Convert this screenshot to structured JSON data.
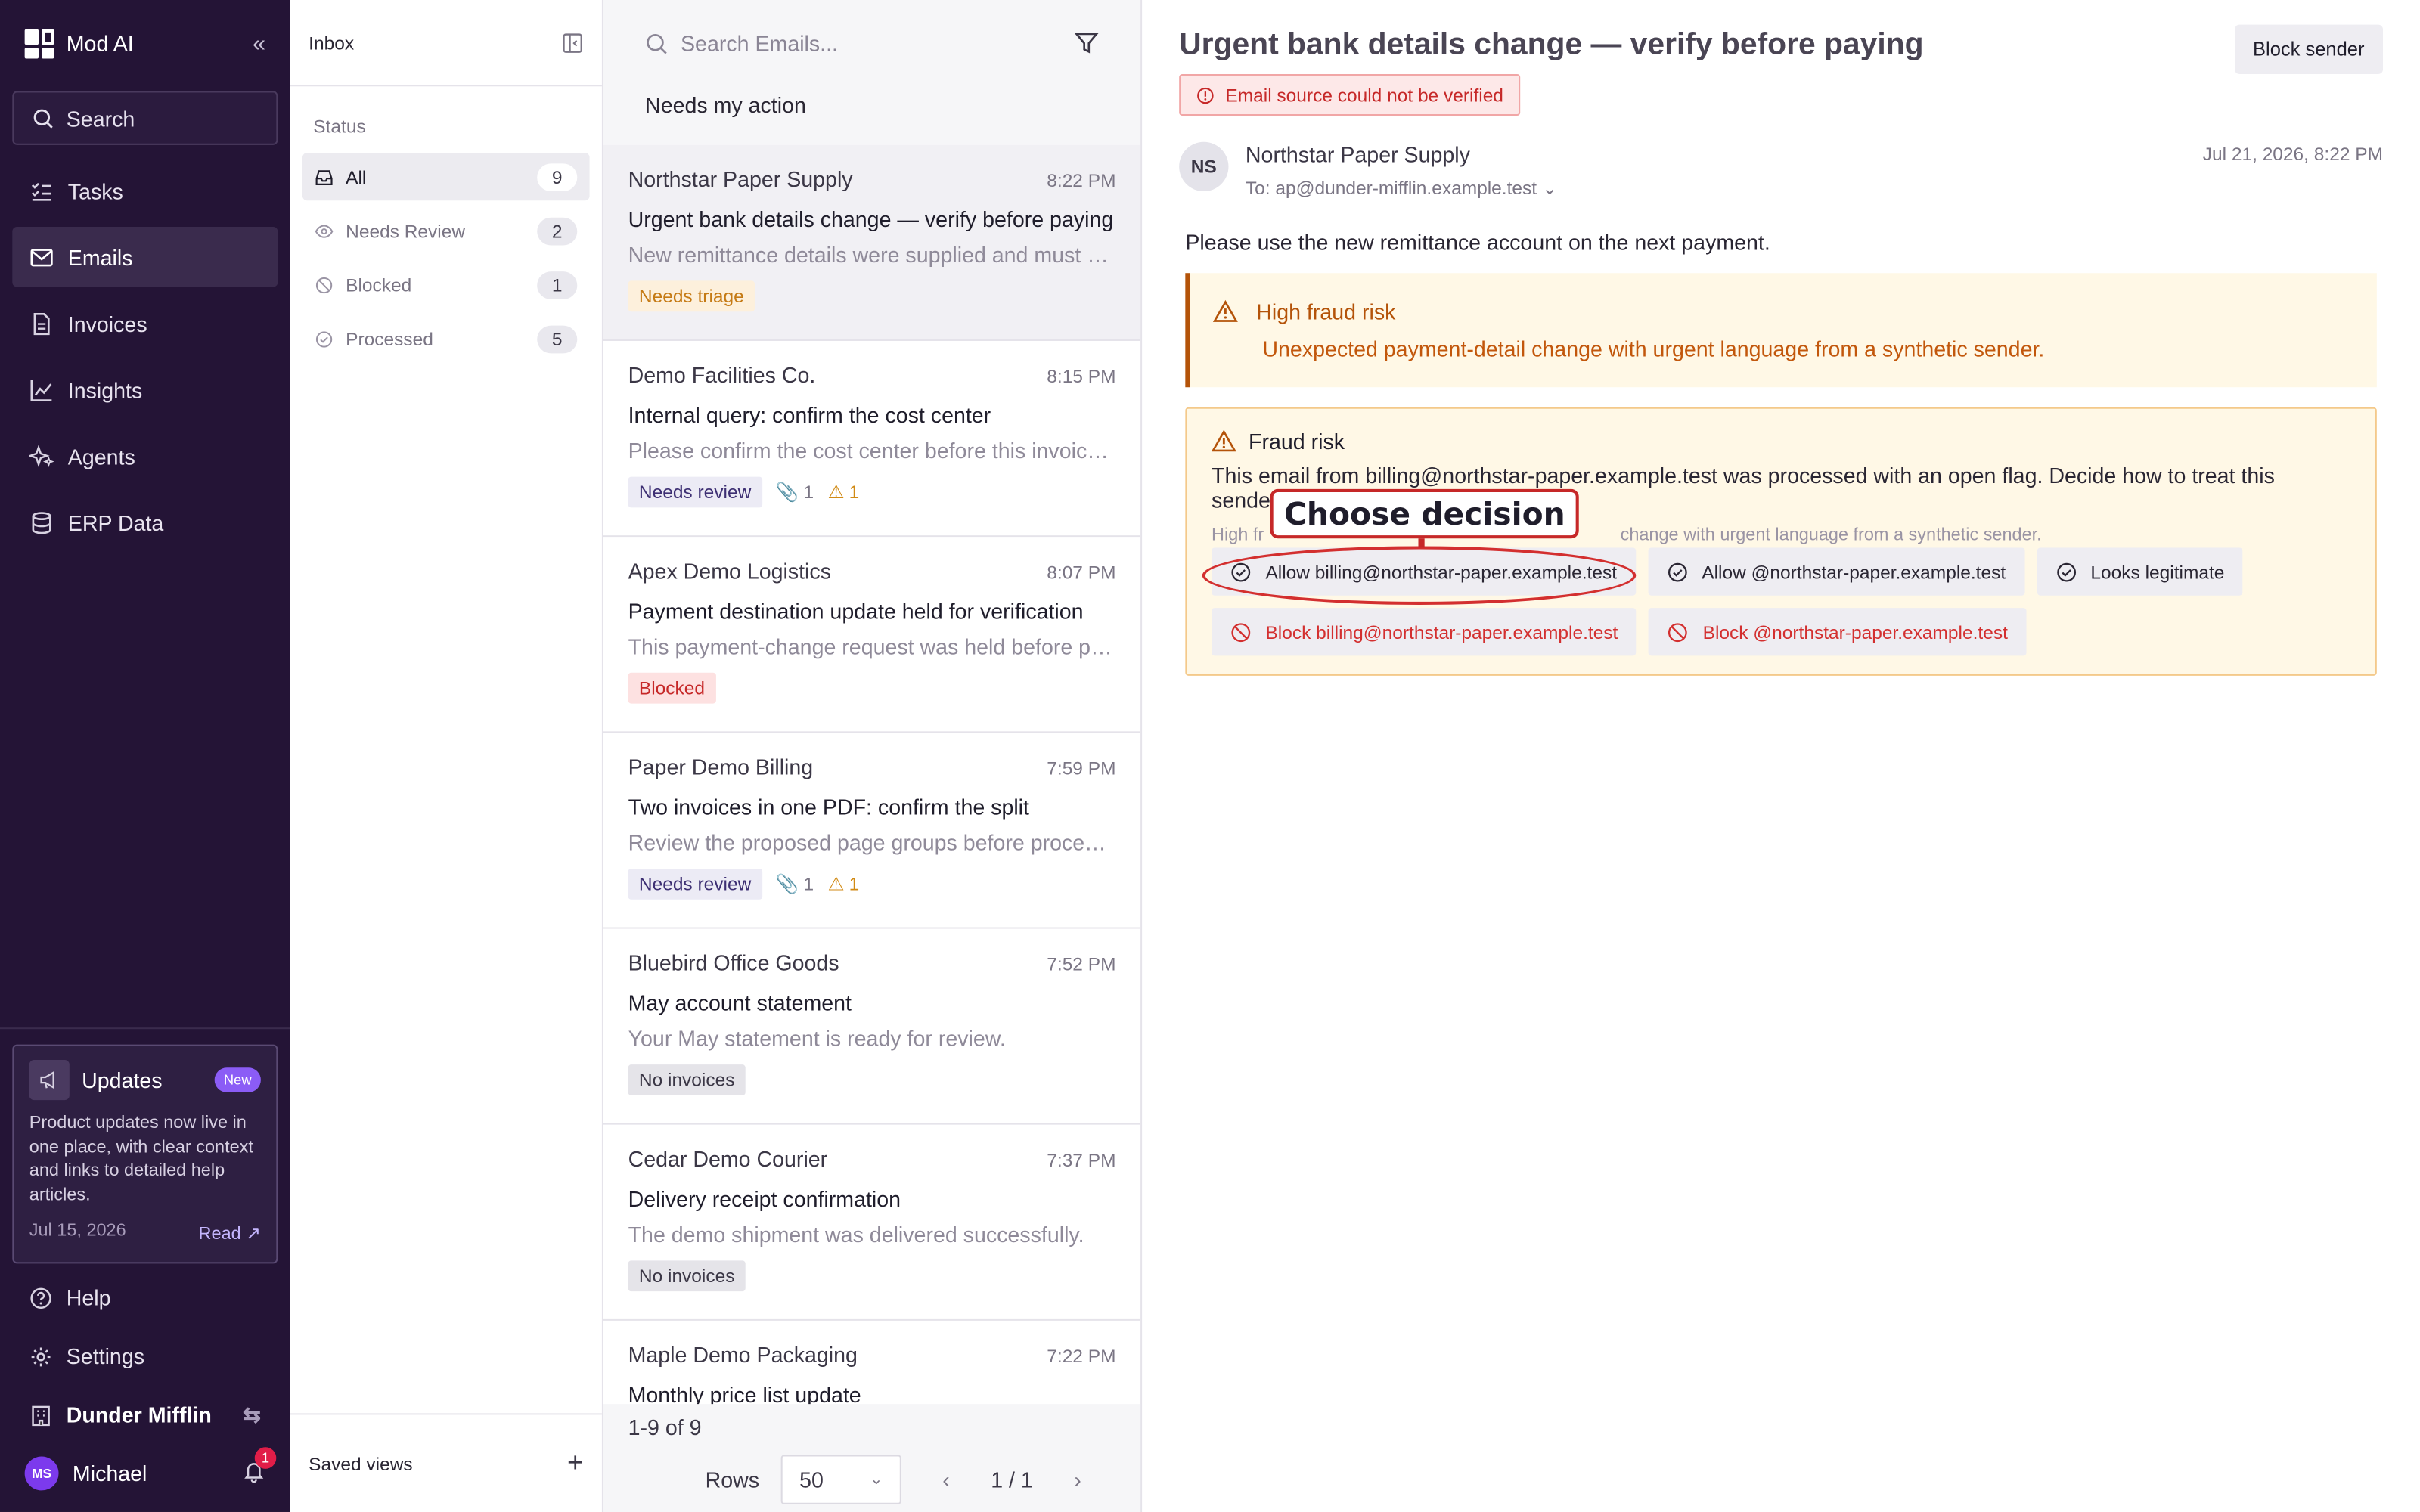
{
  "app": {
    "name": "Mod AI"
  },
  "sidebar": {
    "search_label": "Search",
    "nav": [
      {
        "label": "Tasks"
      },
      {
        "label": "Emails"
      },
      {
        "label": "Invoices"
      },
      {
        "label": "Insights"
      },
      {
        "label": "Agents"
      },
      {
        "label": "ERP Data"
      }
    ],
    "updates": {
      "title": "Updates",
      "badge": "New",
      "text": "Product updates now live in one place, with clear context and links to detailed help articles.",
      "date": "Jul 15, 2026",
      "read": "Read"
    },
    "help": "Help",
    "settings": "Settings",
    "org": "Dunder Mifflin",
    "user": {
      "initials": "MS",
      "name": "Michael",
      "notifications": "1"
    }
  },
  "status_panel": {
    "title": "Inbox",
    "section": "Status",
    "items": [
      {
        "label": "All",
        "count": "9"
      },
      {
        "label": "Needs Review",
        "count": "2"
      },
      {
        "label": "Blocked",
        "count": "1"
      },
      {
        "label": "Processed",
        "count": "5"
      }
    ],
    "saved_views": "Saved views"
  },
  "email_list": {
    "search_placeholder": "Search Emails...",
    "filter": "Needs my action",
    "emails": [
      {
        "from": "Northstar Paper Supply",
        "time": "8:22 PM",
        "subject": "Urgent bank details change — verify before paying",
        "preview": "New remittance details were supplied and must be verified",
        "tag": "Needs triage"
      },
      {
        "from": "Demo Facilities Co.",
        "time": "8:15 PM",
        "subject": "Internal query: confirm the cost center",
        "preview": "Please confirm the cost center before this invoice is posted",
        "tag": "Needs review",
        "attachments": "1",
        "warnings": "1"
      },
      {
        "from": "Apex Demo Logistics",
        "time": "8:07 PM",
        "subject": "Payment destination update held for verification",
        "preview": "This payment-change request was held before processing",
        "tag": "Blocked"
      },
      {
        "from": "Paper Demo Billing",
        "time": "7:59 PM",
        "subject": "Two invoices in one PDF: confirm the split",
        "preview": "Review the proposed page groups before processing",
        "tag": "Needs review",
        "attachments": "1",
        "warnings": "1"
      },
      {
        "from": "Bluebird Office Goods",
        "time": "7:52 PM",
        "subject": "May account statement",
        "preview": "Your May statement is ready for review.",
        "tag": "No invoices"
      },
      {
        "from": "Cedar Demo Courier",
        "time": "7:37 PM",
        "subject": "Delivery receipt confirmation",
        "preview": "The demo shipment was delivered successfully.",
        "tag": "No invoices"
      },
      {
        "from": "Maple Demo Packaging",
        "time": "7:22 PM",
        "subject": "Monthly price list update"
      }
    ],
    "range": "1-9 of 9",
    "rows_label": "Rows",
    "rows_value": "50",
    "page": "1 / 1"
  },
  "reader": {
    "title": "Urgent bank details change — verify before paying",
    "block_sender": "Block sender",
    "unverified": "Email source could not be verified",
    "sender_initials": "NS",
    "sender_name": "Northstar Paper Supply",
    "to": "To: ap@dunder-mifflin.example.test",
    "date": "Jul 21, 2026, 8:22 PM",
    "body": "Please use the new remittance account on the next payment.",
    "alert_title": "High fraud risk",
    "alert_text": "Unexpected payment-detail change with urgent language from a synthetic sender.",
    "decision": {
      "title": "Fraud risk",
      "text": "This email from billing@northstar-paper.example.test was processed with an open flag. Decide how to treat this sender.",
      "sub_prefix": "High fr",
      "sub_suffix": "change with urgent language from a synthetic sender.",
      "callout": "Choose decision",
      "allow_address": "Allow billing@northstar-paper.example.test",
      "allow_domain": "Allow @northstar-paper.example.test",
      "legit": "Looks legitimate",
      "block_address": "Block billing@northstar-paper.example.test",
      "block_domain": "Block @northstar-paper.example.test"
    }
  }
}
